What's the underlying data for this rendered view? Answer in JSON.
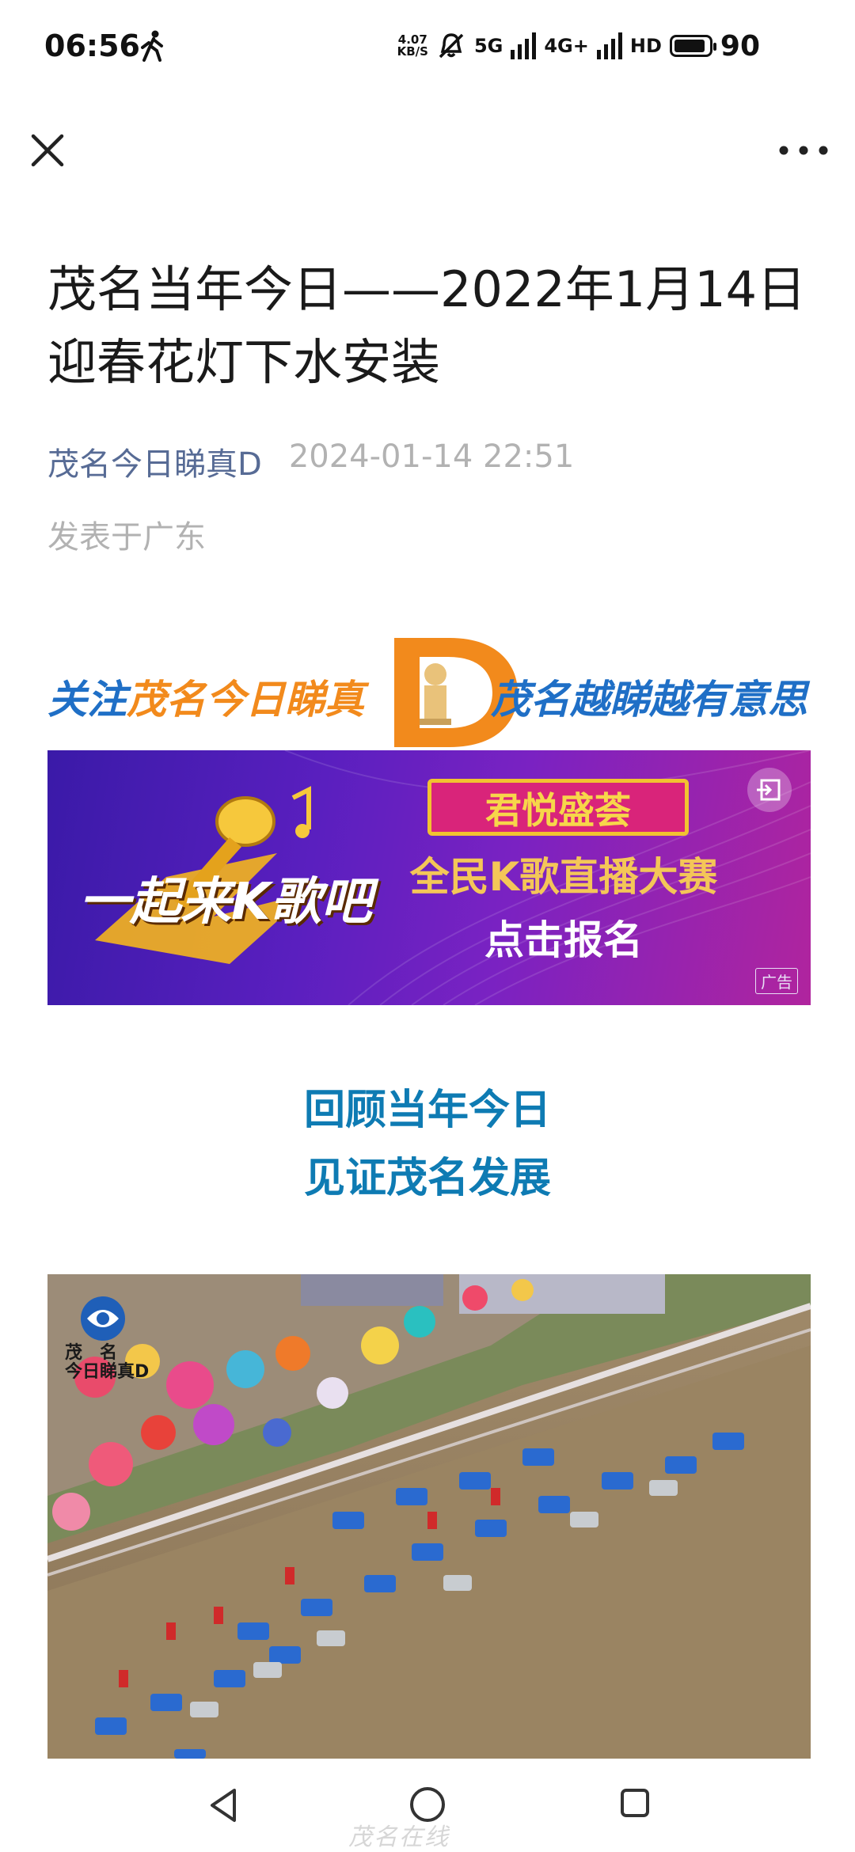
{
  "status_bar": {
    "time": "06:56",
    "net_speed_value": "4.07",
    "net_speed_unit": "KB/S",
    "signal1": "5G",
    "signal2": "4G+",
    "hd": "HD",
    "battery": "90",
    "battery_level": 0.9
  },
  "nav": {
    "close_icon": "close-icon",
    "more_icon": "more-icon"
  },
  "article": {
    "title": "茂名当年今日——2022年1月14日迎春花灯下水安装",
    "author": "茂名今日睇真D",
    "datetime": "2024-01-14 22:51",
    "location": "发表于广东"
  },
  "follow_banner": {
    "part1": "关注",
    "part2": "茂名今日睇真",
    "part3": "茂名越睇越有意思"
  },
  "ad": {
    "left_text": "一起来K歌吧",
    "badge": "君悦盛荟",
    "line2": "全民K歌直播大赛",
    "line3": "点击报名",
    "tag": "广告"
  },
  "headline": {
    "line1": "回顾当年今日",
    "line2": "见证茂名发展"
  },
  "photo": {
    "logo_line1": "茂　名",
    "logo_line2": "今日睇真D"
  },
  "watermark": "茂名在线",
  "colors": {
    "author_link": "#576b95",
    "headline": "#0e7bb3",
    "meta_gray": "#b2b2b2"
  }
}
